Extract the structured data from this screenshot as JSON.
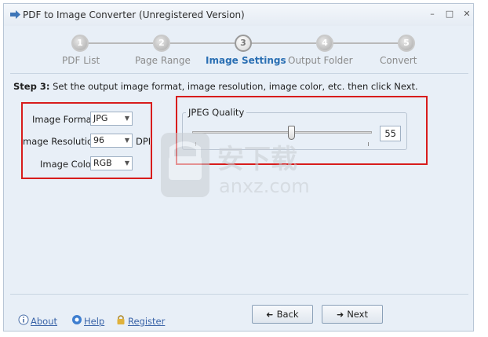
{
  "window": {
    "title": "PDF to Image Converter (Unregistered Version)",
    "controls": {
      "minimize": "–",
      "maximize": "□",
      "close": "✕"
    }
  },
  "wizard": {
    "steps": [
      {
        "number": "1",
        "label": "PDF List"
      },
      {
        "number": "2",
        "label": "Page Range"
      },
      {
        "number": "3",
        "label": "Image Settings",
        "active": true
      },
      {
        "number": "4",
        "label": "Output Folder"
      },
      {
        "number": "5",
        "label": "Convert"
      }
    ]
  },
  "step": {
    "heading": "Step 3:",
    "instruction": "Set the output image format, image resolution, image color, etc. then click Next."
  },
  "settings": {
    "format_label": "Image Format:",
    "format_value": "JPG",
    "resolution_label": "mage Resolution:",
    "resolution_value": "96",
    "resolution_unit": "DPI",
    "color_label": "Image Color:",
    "color_value": "RGB"
  },
  "jpeg_quality": {
    "title": "JPEG Quality",
    "value": "55",
    "slider_fraction": 0.55
  },
  "watermark": {
    "text": "安下载",
    "subtext": "anxz.com"
  },
  "footer": {
    "about": "About",
    "help": "Help",
    "register": "Register",
    "back": "Back",
    "next": "Next"
  },
  "icons": {
    "app": "pdf-image-icon",
    "about": "info-icon",
    "help": "help-icon",
    "register": "lock-icon",
    "back": "back-arrow-icon",
    "next": "next-arrow-icon"
  },
  "colors": {
    "highlight": "#d81c1c",
    "active_step": "#2a6fb3",
    "link": "#3a64a8"
  }
}
